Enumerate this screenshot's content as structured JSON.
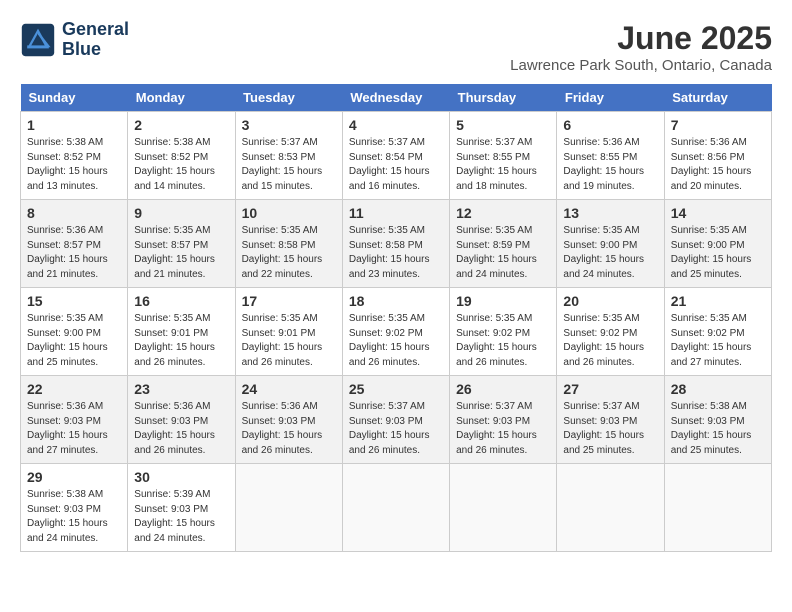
{
  "logo": {
    "line1": "General",
    "line2": "Blue"
  },
  "title": "June 2025",
  "subtitle": "Lawrence Park South, Ontario, Canada",
  "headers": [
    "Sunday",
    "Monday",
    "Tuesday",
    "Wednesday",
    "Thursday",
    "Friday",
    "Saturday"
  ],
  "weeks": [
    [
      {
        "day": "1",
        "sunrise": "5:38 AM",
        "sunset": "8:52 PM",
        "daylight": "15 hours and 13 minutes."
      },
      {
        "day": "2",
        "sunrise": "5:38 AM",
        "sunset": "8:52 PM",
        "daylight": "15 hours and 14 minutes."
      },
      {
        "day": "3",
        "sunrise": "5:37 AM",
        "sunset": "8:53 PM",
        "daylight": "15 hours and 15 minutes."
      },
      {
        "day": "4",
        "sunrise": "5:37 AM",
        "sunset": "8:54 PM",
        "daylight": "15 hours and 16 minutes."
      },
      {
        "day": "5",
        "sunrise": "5:37 AM",
        "sunset": "8:55 PM",
        "daylight": "15 hours and 18 minutes."
      },
      {
        "day": "6",
        "sunrise": "5:36 AM",
        "sunset": "8:55 PM",
        "daylight": "15 hours and 19 minutes."
      },
      {
        "day": "7",
        "sunrise": "5:36 AM",
        "sunset": "8:56 PM",
        "daylight": "15 hours and 20 minutes."
      }
    ],
    [
      {
        "day": "8",
        "sunrise": "5:36 AM",
        "sunset": "8:57 PM",
        "daylight": "15 hours and 21 minutes."
      },
      {
        "day": "9",
        "sunrise": "5:35 AM",
        "sunset": "8:57 PM",
        "daylight": "15 hours and 21 minutes."
      },
      {
        "day": "10",
        "sunrise": "5:35 AM",
        "sunset": "8:58 PM",
        "daylight": "15 hours and 22 minutes."
      },
      {
        "day": "11",
        "sunrise": "5:35 AM",
        "sunset": "8:58 PM",
        "daylight": "15 hours and 23 minutes."
      },
      {
        "day": "12",
        "sunrise": "5:35 AM",
        "sunset": "8:59 PM",
        "daylight": "15 hours and 24 minutes."
      },
      {
        "day": "13",
        "sunrise": "5:35 AM",
        "sunset": "9:00 PM",
        "daylight": "15 hours and 24 minutes."
      },
      {
        "day": "14",
        "sunrise": "5:35 AM",
        "sunset": "9:00 PM",
        "daylight": "15 hours and 25 minutes."
      }
    ],
    [
      {
        "day": "15",
        "sunrise": "5:35 AM",
        "sunset": "9:00 PM",
        "daylight": "15 hours and 25 minutes."
      },
      {
        "day": "16",
        "sunrise": "5:35 AM",
        "sunset": "9:01 PM",
        "daylight": "15 hours and 26 minutes."
      },
      {
        "day": "17",
        "sunrise": "5:35 AM",
        "sunset": "9:01 PM",
        "daylight": "15 hours and 26 minutes."
      },
      {
        "day": "18",
        "sunrise": "5:35 AM",
        "sunset": "9:02 PM",
        "daylight": "15 hours and 26 minutes."
      },
      {
        "day": "19",
        "sunrise": "5:35 AM",
        "sunset": "9:02 PM",
        "daylight": "15 hours and 26 minutes."
      },
      {
        "day": "20",
        "sunrise": "5:35 AM",
        "sunset": "9:02 PM",
        "daylight": "15 hours and 26 minutes."
      },
      {
        "day": "21",
        "sunrise": "5:35 AM",
        "sunset": "9:02 PM",
        "daylight": "15 hours and 27 minutes."
      }
    ],
    [
      {
        "day": "22",
        "sunrise": "5:36 AM",
        "sunset": "9:03 PM",
        "daylight": "15 hours and 27 minutes."
      },
      {
        "day": "23",
        "sunrise": "5:36 AM",
        "sunset": "9:03 PM",
        "daylight": "15 hours and 26 minutes."
      },
      {
        "day": "24",
        "sunrise": "5:36 AM",
        "sunset": "9:03 PM",
        "daylight": "15 hours and 26 minutes."
      },
      {
        "day": "25",
        "sunrise": "5:37 AM",
        "sunset": "9:03 PM",
        "daylight": "15 hours and 26 minutes."
      },
      {
        "day": "26",
        "sunrise": "5:37 AM",
        "sunset": "9:03 PM",
        "daylight": "15 hours and 26 minutes."
      },
      {
        "day": "27",
        "sunrise": "5:37 AM",
        "sunset": "9:03 PM",
        "daylight": "15 hours and 25 minutes."
      },
      {
        "day": "28",
        "sunrise": "5:38 AM",
        "sunset": "9:03 PM",
        "daylight": "15 hours and 25 minutes."
      }
    ],
    [
      {
        "day": "29",
        "sunrise": "5:38 AM",
        "sunset": "9:03 PM",
        "daylight": "15 hours and 24 minutes."
      },
      {
        "day": "30",
        "sunrise": "5:39 AM",
        "sunset": "9:03 PM",
        "daylight": "15 hours and 24 minutes."
      },
      null,
      null,
      null,
      null,
      null
    ]
  ],
  "labels": {
    "sunrise": "Sunrise:",
    "sunset": "Sunset:",
    "daylight": "Daylight:"
  }
}
